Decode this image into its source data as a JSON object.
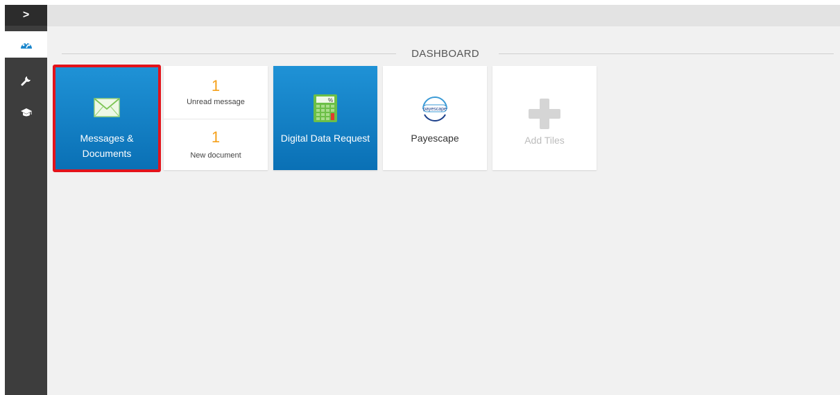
{
  "sidebar": {
    "toggle_label": ">",
    "items": [
      {
        "icon": "dashboard-gauge-icon",
        "active": true
      },
      {
        "icon": "wrench-icon",
        "active": false
      },
      {
        "icon": "graduation-cap-icon",
        "active": false
      }
    ]
  },
  "dashboard": {
    "title": "DASHBOARD",
    "tiles": {
      "messages": {
        "label_line1": "Messages &",
        "label_line2": "Documents",
        "icon": "envelope-icon",
        "highlighted": true,
        "highlight_color": "#e3131b"
      },
      "counts": {
        "unread_count": "1",
        "unread_label": "Unread message",
        "new_doc_count": "1",
        "new_doc_label": "New document"
      },
      "digital": {
        "label": "Digital Data Request",
        "icon": "calculator-icon"
      },
      "payescape": {
        "label": "Payescape",
        "logo_text": "payescape",
        "icon": "payescape-logo"
      },
      "add": {
        "label": "Add Tiles",
        "icon": "plus-icon"
      }
    }
  },
  "colors": {
    "tile_blue": "#1a86cc",
    "accent_orange": "#f5a01a",
    "sidebar_dark": "#3d3d3d",
    "background": "#f1f1f1"
  }
}
